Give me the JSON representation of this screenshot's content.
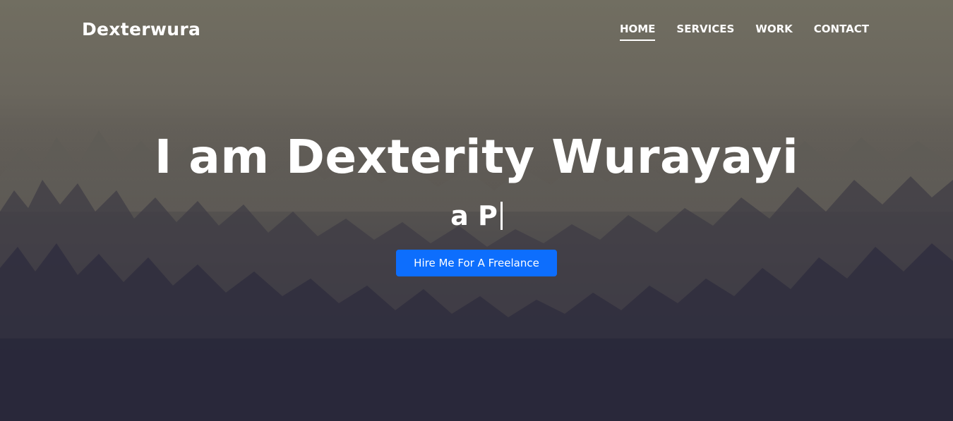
{
  "brand": "Dexterwura",
  "nav": {
    "items": [
      {
        "label": "HOME",
        "active": true
      },
      {
        "label": "SERVICES",
        "active": false
      },
      {
        "label": "WORK",
        "active": false
      },
      {
        "label": "CONTACT",
        "active": false
      }
    ]
  },
  "hero": {
    "title": "I am Dexterity Wurayayi",
    "typed_text": "a P",
    "cta_label": "Hire Me For A Freelance"
  },
  "colors": {
    "accent": "#0d6efd",
    "text": "#ffffff",
    "sky": "#716e61",
    "ground": "#252538"
  }
}
